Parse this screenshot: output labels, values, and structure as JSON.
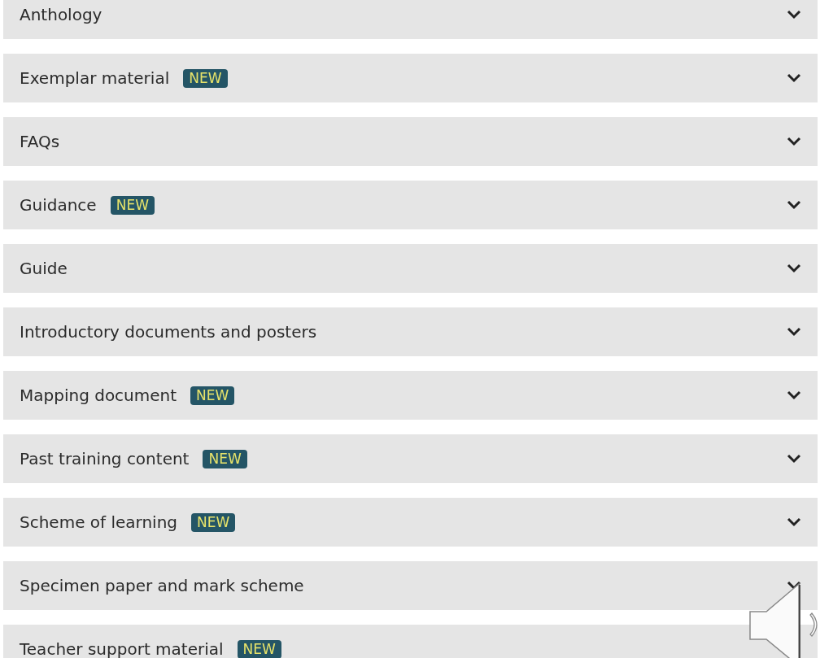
{
  "sections": [
    {
      "title": "Anthology",
      "chevron": true
    },
    {
      "title": "Exemplar material",
      "badge": "NEW",
      "chevron": true
    },
    {
      "title": "FAQs",
      "chevron": true
    },
    {
      "title": "Guidance",
      "badge": "NEW",
      "chevron": true
    },
    {
      "title": "Guide",
      "chevron": true
    },
    {
      "title": "Introductory documents and posters",
      "chevron": true
    },
    {
      "title": "Mapping document",
      "badge": "NEW",
      "chevron": true
    },
    {
      "title": "Past training content",
      "badge": "NEW",
      "chevron": true
    },
    {
      "title": "Scheme of learning",
      "badge": "NEW",
      "chevron": true
    },
    {
      "title": "Specimen paper and mark scheme",
      "chevron": true
    },
    {
      "title": "Teacher support material",
      "badge": "NEW",
      "chevron": false
    }
  ]
}
